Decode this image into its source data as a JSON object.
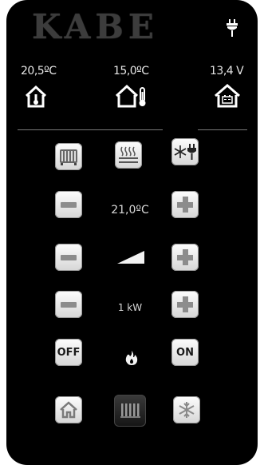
{
  "brand": {
    "logo_text": "KABE"
  },
  "header": {
    "indoor_temp": "20,5ºC",
    "outdoor_temp": "15,0ºC",
    "battery_voltage": "13,4 V"
  },
  "controls": {
    "temp_setpoint": "21,0ºC",
    "power_level": "1 kW",
    "off_label": "OFF",
    "on_label": "ON"
  },
  "icons": {
    "shore_power": "plug-icon",
    "indoor": "house-thermometer-icon",
    "outdoor": "house-outdoor-thermometer-icon",
    "battery": "house-battery-icon",
    "heater": "radiator-icon",
    "floor_heat": "floor-heating-icon",
    "ac": "snowflake-plug-icon",
    "fan_speed": "fan-ramp-icon",
    "flame": "flame-icon",
    "home": "home-icon",
    "heater_nav": "radiator-nav-icon",
    "cooling_nav": "snowflake-icon"
  },
  "colors": {
    "background": "#000000",
    "button": "#e6e6e6",
    "text": "#e6e6e6"
  }
}
